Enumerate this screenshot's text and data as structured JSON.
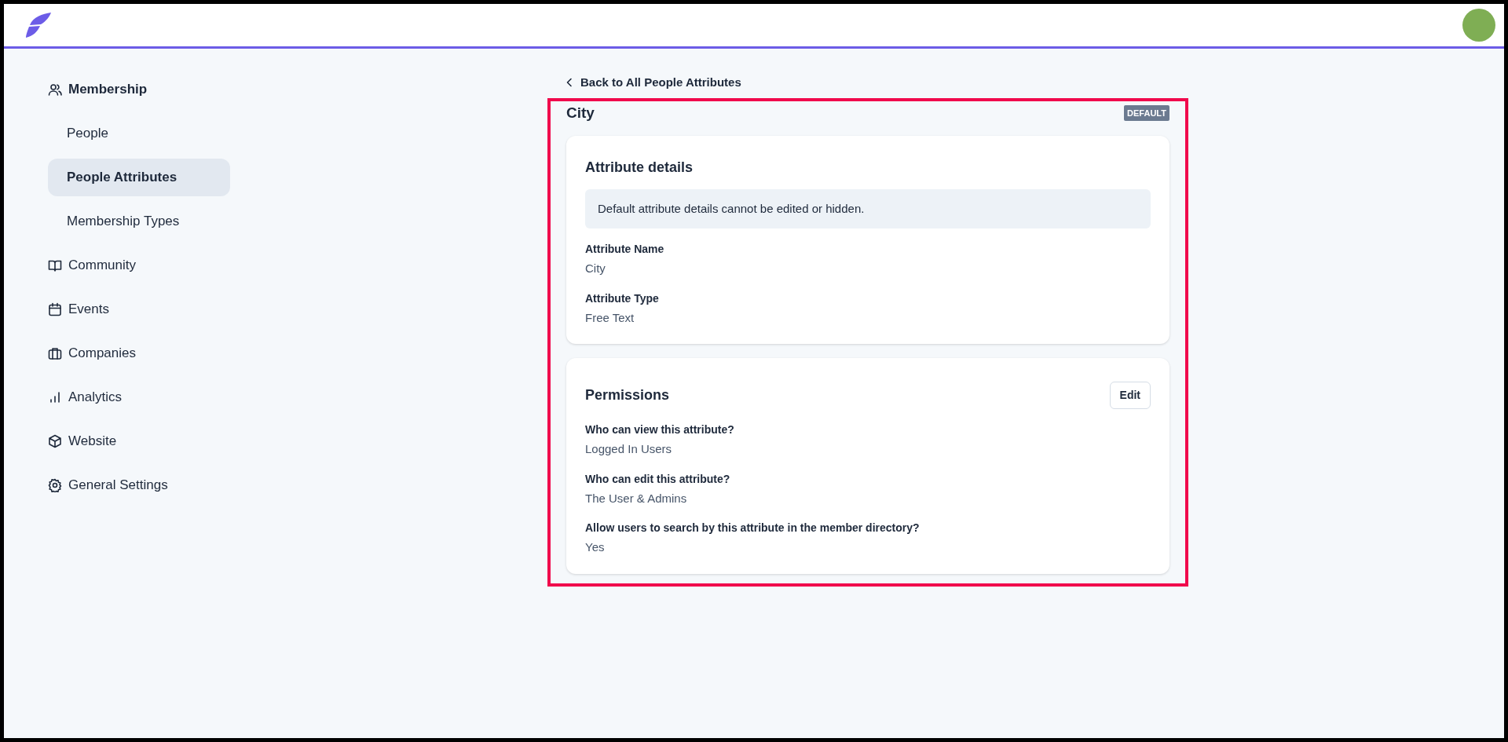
{
  "sidebar": {
    "sections": [
      {
        "label": "Membership",
        "children": [
          {
            "label": "People",
            "selected": false
          },
          {
            "label": "People Attributes",
            "selected": true
          },
          {
            "label": "Membership Types",
            "selected": false
          }
        ]
      },
      {
        "label": "Community"
      },
      {
        "label": "Events"
      },
      {
        "label": "Companies"
      },
      {
        "label": "Analytics"
      },
      {
        "label": "Website"
      },
      {
        "label": "General Settings"
      }
    ]
  },
  "back_link": "Back to All People Attributes",
  "title": "City",
  "badge": "DEFAULT",
  "cards": [
    {
      "title": "Attribute details",
      "notice": "Default attribute details cannot be edited or hidden.",
      "fields": [
        {
          "label": "Attribute Name",
          "value": "City"
        },
        {
          "label": "Attribute Type",
          "value": "Free Text"
        }
      ]
    },
    {
      "title": "Permissions",
      "button": "Edit",
      "fields": [
        {
          "label": "Who can view this attribute?",
          "value": "Logged In Users"
        },
        {
          "label": "Who can edit this attribute?",
          "value": "The User & Admins"
        },
        {
          "label": "Allow users to search by this attribute in the member directory?",
          "value": "Yes"
        }
      ]
    }
  ]
}
